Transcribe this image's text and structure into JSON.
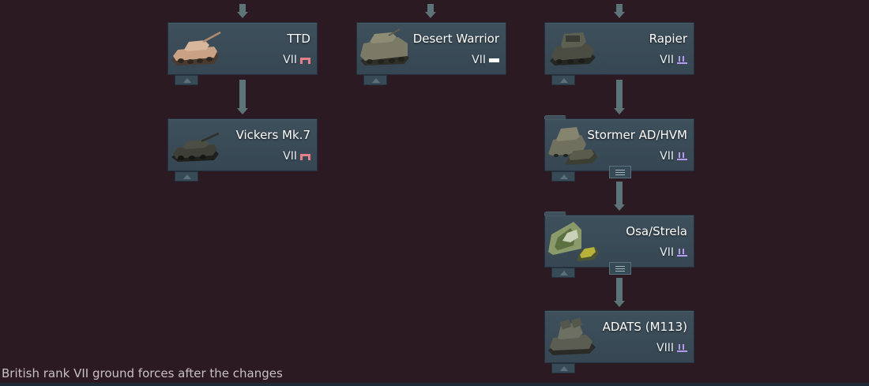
{
  "colors": {
    "background": "#2c1a23",
    "card": "#3e505c",
    "connector": "#5c7377",
    "premium_icon": "#e77f8a",
    "squadron_icon": "#b69af0",
    "regular_icon": "#ffffff"
  },
  "caption": "British rank VII ground forces after the changes",
  "vehicles": {
    "ttd": {
      "name": "TTD",
      "rank": "VII",
      "type_icon": "premium-icon"
    },
    "desert_warrior": {
      "name": "Desert Warrior",
      "rank": "VII",
      "type_icon": "researchable-icon"
    },
    "rapier": {
      "name": "Rapier",
      "rank": "VII",
      "type_icon": "squadron-icon"
    },
    "vickers": {
      "name": "Vickers Mk.7",
      "rank": "VII",
      "type_icon": "premium-icon"
    },
    "stormer": {
      "name": "Stormer AD/HVM",
      "rank": "VII",
      "type_icon": "squadron-icon"
    },
    "osa": {
      "name": "Osa/Strela",
      "rank": "VII",
      "type_icon": "squadron-icon"
    },
    "adats": {
      "name": "ADATS (M113)",
      "rank": "VIII",
      "type_icon": "squadron-icon"
    }
  }
}
